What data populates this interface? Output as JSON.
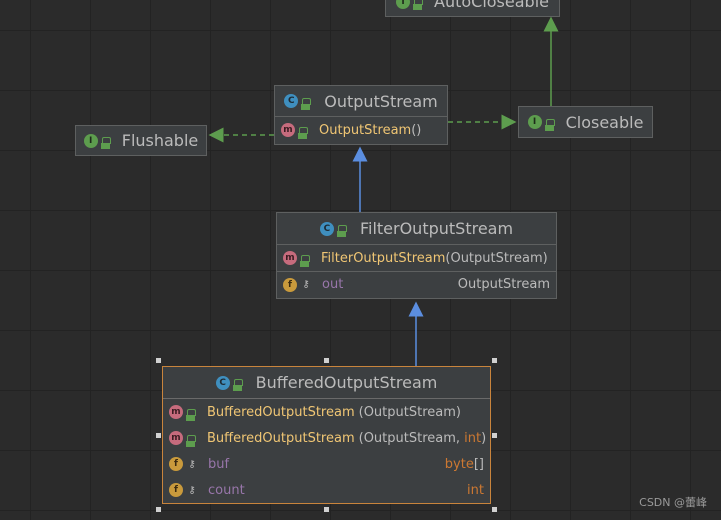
{
  "colors": {
    "background": "#2b2b2b",
    "node_fill": "#3c3f41",
    "node_border": "#5e6060",
    "selected_border": "#c9843c",
    "inherit_edge": "#5b8ee0",
    "implement_edge": "#5d9d4e",
    "method_name": "#f0c674",
    "field_name": "#9876aa",
    "keyword": "#cc7832"
  },
  "nodes": {
    "autocloseable": {
      "kind": "interface",
      "icon": "interface-icon",
      "name": "AutoCloseable"
    },
    "outputstream": {
      "kind": "class",
      "icon": "class-icon",
      "name": "OutputStream",
      "methods": [
        {
          "name": "OutputStream",
          "params": "()"
        }
      ]
    },
    "flushable": {
      "kind": "interface",
      "icon": "interface-icon",
      "name": "Flushable"
    },
    "closeable": {
      "kind": "interface",
      "icon": "interface-icon",
      "name": "Closeable"
    },
    "filteroutputstream": {
      "kind": "class",
      "icon": "class-icon",
      "name": "FilterOutputStream",
      "methods": [
        {
          "name": "FilterOutputStream",
          "params": "(OutputStream)"
        }
      ],
      "fields": [
        {
          "name": "out",
          "type": "OutputStream"
        }
      ]
    },
    "bufferedoutputstream": {
      "kind": "class",
      "icon": "class-icon",
      "name": "BufferedOutputStream",
      "selected": true,
      "methods": [
        {
          "name": "BufferedOutputStream",
          "params": "(OutputStream)"
        },
        {
          "name": "BufferedOutputStream",
          "params_prefix": "(OutputStream, ",
          "params_kw": "int",
          "params_suffix": ")"
        }
      ],
      "fields": [
        {
          "name": "buf",
          "type_kw": "byte",
          "type_suffix": "[]"
        },
        {
          "name": "count",
          "type_kw": "int"
        }
      ]
    }
  },
  "edges": [
    {
      "from": "OutputStream",
      "to": "Flushable",
      "kind": "implements"
    },
    {
      "from": "OutputStream",
      "to": "Closeable",
      "kind": "implements"
    },
    {
      "from": "Closeable",
      "to": "AutoCloseable",
      "kind": "extends"
    },
    {
      "from": "FilterOutputStream",
      "to": "OutputStream",
      "kind": "extends"
    },
    {
      "from": "BufferedOutputStream",
      "to": "FilterOutputStream",
      "kind": "extends"
    }
  ],
  "icon_letters": {
    "class": "C",
    "interface": "I",
    "method": "m",
    "field": "f"
  },
  "watermark": "CSDN @蕾峰"
}
